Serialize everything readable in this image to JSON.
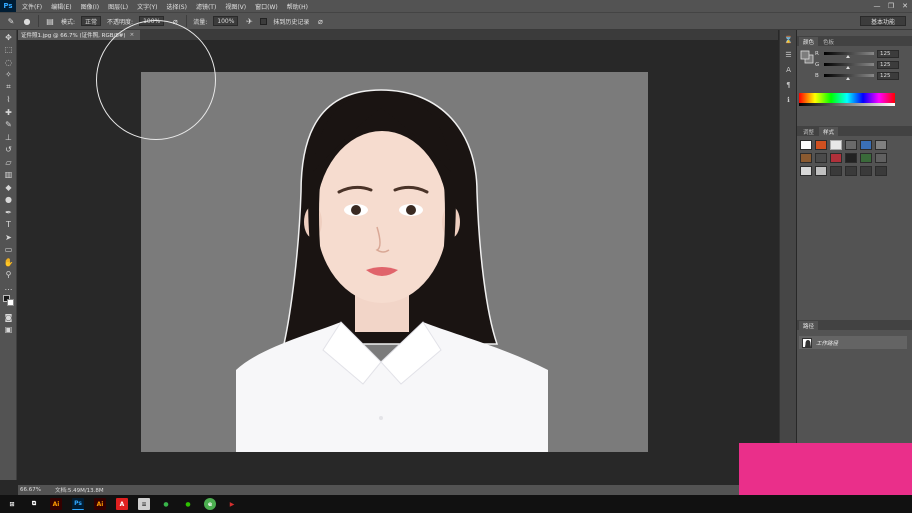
{
  "app": {
    "logo": "Ps"
  },
  "menu": [
    "文件(F)",
    "编辑(E)",
    "图像(I)",
    "图层(L)",
    "文字(Y)",
    "选择(S)",
    "滤镜(T)",
    "视图(V)",
    "窗口(W)",
    "帮助(H)"
  ],
  "window_controls": {
    "minimize": "—",
    "restore": "❐",
    "close": "✕"
  },
  "options_bar": {
    "mode_label": "模式:",
    "mode_value": "正常",
    "opacity_label": "不透明度:",
    "opacity_value": "100%",
    "flow_label": "流量:",
    "flow_value": "100%",
    "history_label": "抹到历史记录",
    "workspace": "基本功能"
  },
  "document": {
    "tab_title": "证件照1.jpg @ 66.7% (证件照, RGB/8#)",
    "close": "×"
  },
  "status_bar": {
    "zoom": "66.67%",
    "doc_info": "文档:5.49M/13.8M"
  },
  "color_panel": {
    "tabs": [
      "颜色",
      "色板"
    ],
    "channels": [
      {
        "name": "R",
        "value": "125"
      },
      {
        "name": "G",
        "value": "125"
      },
      {
        "name": "B",
        "value": "125"
      }
    ]
  },
  "styles_panel": {
    "tabs": [
      "调整",
      "样式"
    ]
  },
  "paths_panel": {
    "tabs": [
      "路径"
    ],
    "item": "工作路径"
  },
  "taskbar": {
    "icons": [
      {
        "name": "windows-start-icon",
        "label": "⊞",
        "color": "#ffffff"
      },
      {
        "name": "task-view-icon",
        "label": "⧉",
        "color": "#ffffff"
      },
      {
        "name": "illustrator-icon",
        "label": "Ai",
        "color": "#ff9a00"
      },
      {
        "name": "photoshop-icon",
        "label": "Ps",
        "color": "#31a8ff"
      },
      {
        "name": "illustrator-icon-2",
        "label": "Ai",
        "color": "#ff9a00"
      },
      {
        "name": "acrobat-icon",
        "label": "A",
        "color": "#e02020"
      },
      {
        "name": "files-icon",
        "label": "≡",
        "color": "#cfcfcf"
      },
      {
        "name": "chat-icon",
        "label": "●",
        "color": "#39b54a"
      },
      {
        "name": "wechat-icon",
        "label": "●",
        "color": "#2dc100"
      },
      {
        "name": "browser-icon",
        "label": "e",
        "color": "#4caf50"
      },
      {
        "name": "video-icon",
        "label": "▶",
        "color": "#d32f2f"
      }
    ]
  }
}
